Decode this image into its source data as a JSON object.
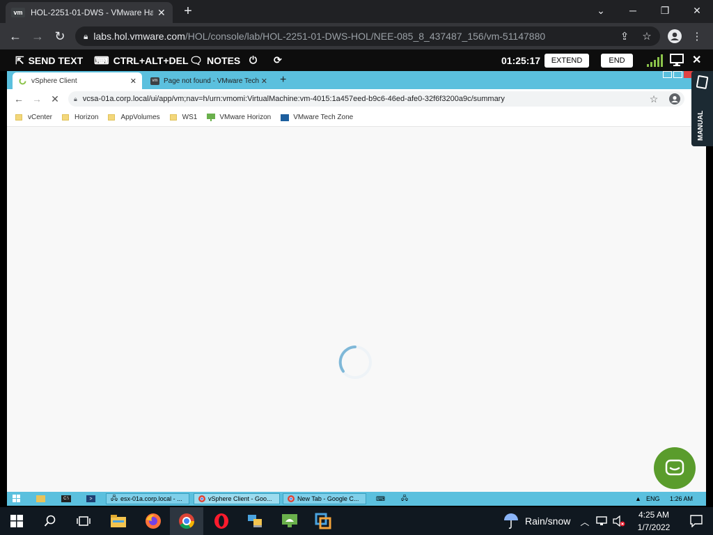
{
  "outer_browser": {
    "tab_title": "HOL-2251-01-DWS - VMware Hands-on Lab",
    "tab_favicon_text": "vm",
    "url_host": "labs.hol.vmware.com",
    "url_path": "/HOL/console/lab/HOL-2251-01-DWS-HOL/NEE-085_8_437487_156/vm-51147880"
  },
  "hol_bar": {
    "send_text": "SEND TEXT",
    "ctrl_alt_del": "CTRL+ALT+DEL",
    "notes": "NOTES",
    "timer": "01:25:17",
    "extend": "EXTEND",
    "end": "END",
    "manual": "MANUAL"
  },
  "vm_browser": {
    "tabs": [
      {
        "title": "vSphere Client"
      },
      {
        "title": "Page not found - VMware Tech Zone"
      }
    ],
    "url": "vcsa-01a.corp.local/ui/app/vm;nav=h/urn:vmomi:VirtualMachine:vm-4015:1a457eed-b9c6-46ed-afe0-32f6f3200a9c/summary",
    "bookmarks": [
      "vCenter",
      "Horizon",
      "AppVolumes",
      "WS1",
      "VMware Horizon",
      "VMware Tech Zone"
    ]
  },
  "vm_taskbar": {
    "windows": [
      "esx-01a.corp.local - ...",
      "vSphere Client - Goo...",
      "New Tab - Google C..."
    ],
    "lang": "ENG",
    "time": "1:26 AM"
  },
  "win_taskbar": {
    "weather": "Rain/snow",
    "time": "4:25 AM",
    "date": "1/7/2022"
  }
}
